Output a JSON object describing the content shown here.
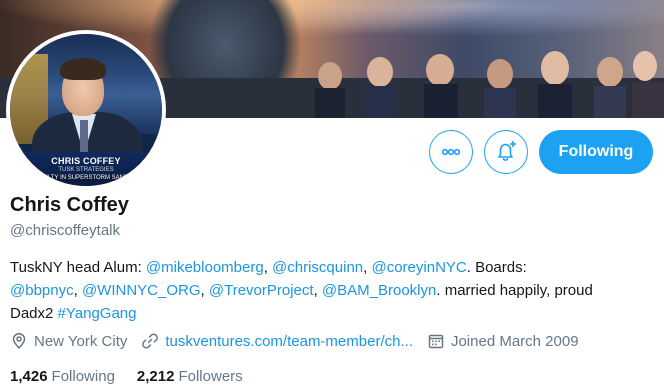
{
  "profile": {
    "name": "Chris Coffey",
    "handle": "@chriscoffeytalk",
    "bio": {
      "line1_text": "TuskNY head Alum: ",
      "mention1": "@mikebloomberg",
      "sep1": ", ",
      "mention2": "@chriscquinn",
      "sep2": ", ",
      "mention3": "@coreyinNYC",
      "line1_tail": ". Boards:",
      "mention4": "@bbpnyc",
      "sep3": ", ",
      "mention5": "@WINNYC_ORG",
      "sep4": ", ",
      "mention6": "@TrevorProject",
      "sep5": ", ",
      "mention7": "@BAM_Brooklyn",
      "line2_tail": ". married happily, proud",
      "line3_text": "Dadx2 ",
      "hashtag": "#YangGang"
    },
    "location": "New York City",
    "url": "tuskventures.com/team-member/ch...",
    "joined": "Joined March 2009",
    "following_count": "1,426",
    "following_label": "Following",
    "followers_count": "2,212",
    "followers_label": "Followers"
  },
  "avatar": {
    "caption_name": "CHRIS COFFEY",
    "caption_org": "TUSK STRATEGIES",
    "ticker": "ULTY IN SUPERSTORM SAND"
  },
  "actions": {
    "following_label": "Following",
    "more_icon": "more-icon",
    "notify_icon": "bell-add-icon"
  },
  "colors": {
    "accent": "#1da1f2",
    "link": "#1b95e0",
    "secondary_text": "#657786"
  }
}
